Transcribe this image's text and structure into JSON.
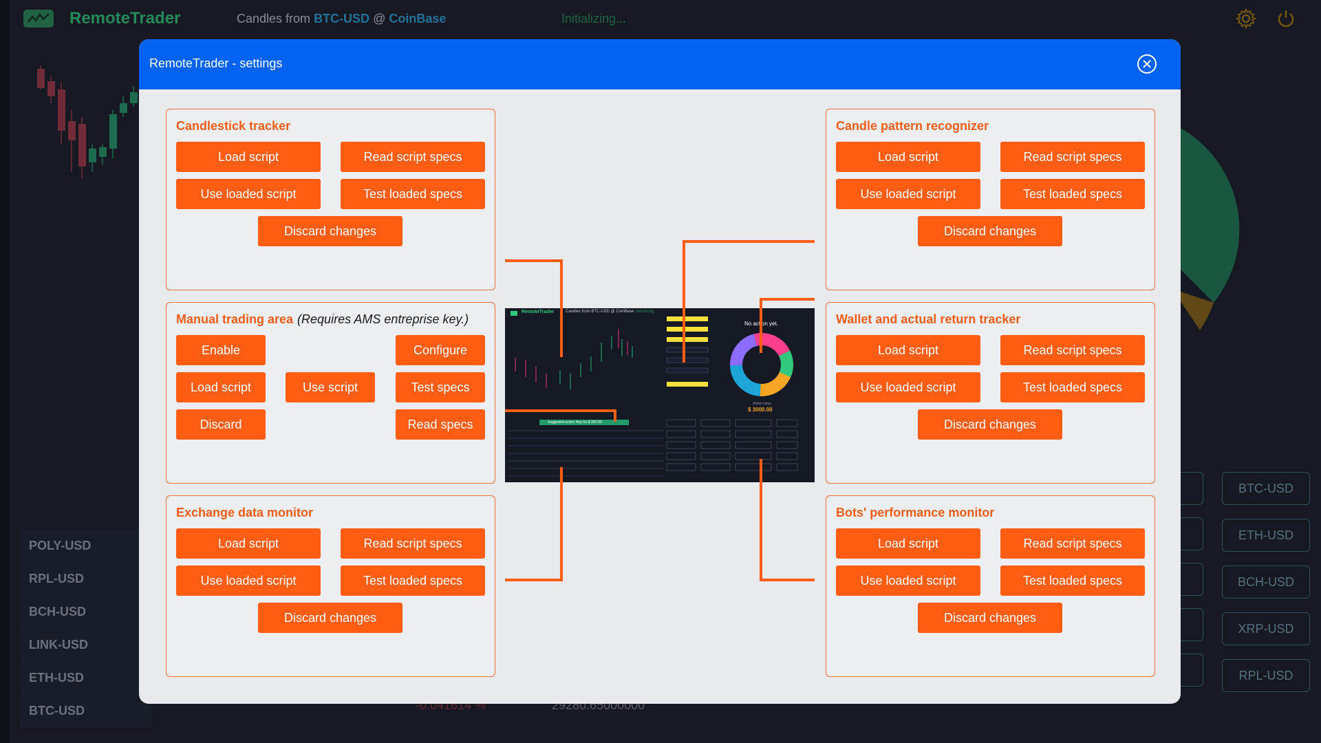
{
  "app": {
    "name": "RemoteTrader",
    "candles_label": "Candles from",
    "pair": "BTC-USD",
    "at": "@",
    "exchange": "CoinBase",
    "status": "Initializing..."
  },
  "background": {
    "left_list": [
      "POLY-USD",
      "RPL-USD",
      "BCH-USD",
      "LINK-USD",
      "ETH-USD",
      "BTC-USD"
    ],
    "right_buttons": [
      "BTC-USD",
      "ETH-USD",
      "BCH-USD",
      "XRP-USD",
      "RPL-USD"
    ],
    "bottom_pct": "-0.041614  %",
    "bottom_price": "29280.65000000"
  },
  "modal": {
    "title": "RemoteTrader - settings",
    "panels": {
      "candlestick": {
        "title": "Candlestick tracker",
        "load": "Load script",
        "read": "Read script specs",
        "use": "Use loaded script",
        "test": "Test loaded specs",
        "discard": "Discard changes"
      },
      "pattern": {
        "title": "Candle pattern recognizer",
        "load": "Load script",
        "read": "Read script specs",
        "use": "Use loaded script",
        "test": "Test loaded specs",
        "discard": "Discard changes"
      },
      "manual": {
        "title": "Manual trading area",
        "note": "(Requires AMS entreprise key.)",
        "enable": "Enable",
        "configure": "Configure",
        "load": "Load script",
        "use": "Use script",
        "test": "Test specs",
        "discard": "Discard",
        "read": "Read specs"
      },
      "wallet": {
        "title": "Wallet and actual return tracker",
        "load": "Load script",
        "read": "Read script specs",
        "use": "Use loaded script",
        "test": "Test loaded specs",
        "discard": "Discard changes"
      },
      "exchange": {
        "title": "Exchange data monitor",
        "load": "Load script",
        "read": "Read script specs",
        "use": "Use loaded script",
        "test": "Test loaded specs",
        "discard": "Discard changes"
      },
      "bots": {
        "title": "Bots' performance monitor",
        "load": "Load script",
        "read": "Read script specs",
        "use": "Use loaded script",
        "test": "Test loaded specs",
        "discard": "Discard changes"
      }
    },
    "preview": {
      "app_name": "RemoteTrader",
      "candles": "Candles from BTC-USD @ CoinBase",
      "status": "Initializing...",
      "no_action": "No action yet.",
      "wallet_label": "Wallet value",
      "wallet_value": "$ 3000.00",
      "suggested": "Suggested action: Buy for $ 300.00!"
    }
  },
  "colors": {
    "accent": "#ff5c14",
    "modal_header": "#0062f0",
    "brand_green": "#2fc87d"
  }
}
